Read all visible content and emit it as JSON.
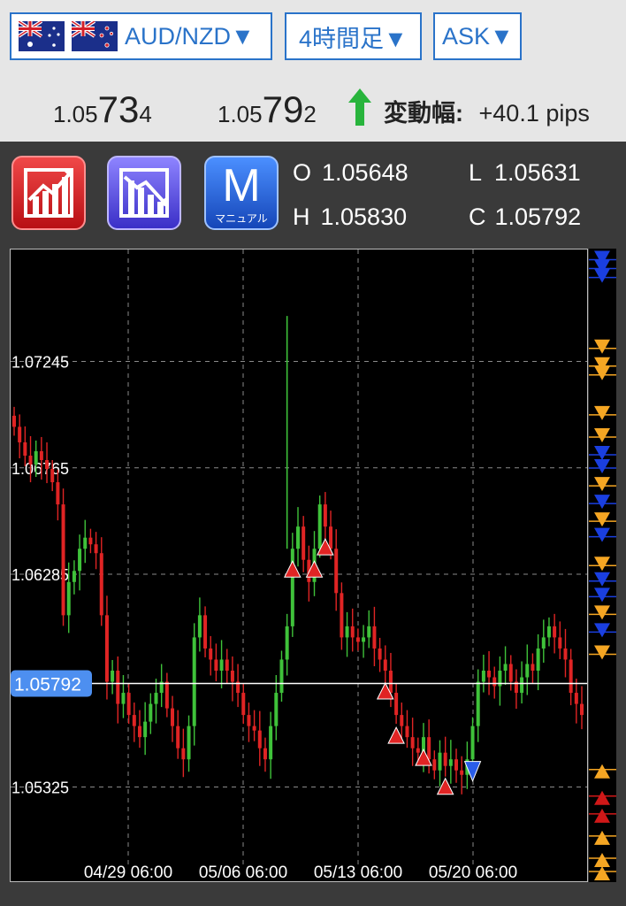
{
  "header": {
    "pair_label": "AUD/NZD▼",
    "timeframe_label": "4時間足▼",
    "side_label": "ASK▼"
  },
  "prices": {
    "bid_prefix": "1.05",
    "bid_big": "73",
    "bid_suffix": "4",
    "ask_prefix": "1.05",
    "ask_big": "79",
    "ask_suffix": "2",
    "range_label": "変動幅:",
    "range_value": "+40.1  pips",
    "direction": "up"
  },
  "toolbar": {
    "manual_letter": "M",
    "manual_sub": "マニュアル"
  },
  "ohlc": {
    "o_label": "O",
    "o_value": "1.05648",
    "h_label": "H",
    "h_value": "1.05830",
    "l_label": "L",
    "l_value": "1.05631",
    "c_label": "C",
    "c_value": "1.05792"
  },
  "colors": {
    "up": "#3fc23a",
    "down": "#e02424",
    "accent": "#2a73c9",
    "current_label_bg": "#4d8ff0",
    "sidebar_orange": "#f5a623",
    "sidebar_blue": "#1a3fe0",
    "sidebar_red": "#d01818"
  },
  "chart_data": {
    "type": "candlestick",
    "pair": "AUD/NZD",
    "timeframe": "4時間足",
    "ylim": [
      1.049,
      1.0775
    ],
    "y_ticks": [
      "1.07245",
      "1.06765",
      "1.06285",
      "1.05325"
    ],
    "y_tick_values": [
      1.07245,
      1.06765,
      1.06285,
      1.05325
    ],
    "current_price": 1.05792,
    "current_price_label": "1.05792",
    "x_ticks": [
      "04/29 06:00",
      "05/06 06:00",
      "05/13 06:00",
      "05/20 06:00"
    ],
    "grid": true,
    "close_series": [
      1.0695,
      1.0688,
      1.0682,
      1.0678,
      1.0684,
      1.068,
      1.0676,
      1.067,
      1.066,
      1.061,
      1.0625,
      1.063,
      1.064,
      1.0645,
      1.0642,
      1.0638,
      1.061,
      1.058,
      1.0585,
      1.057,
      1.0575,
      1.0565,
      1.056,
      1.0555,
      1.0562,
      1.057,
      1.0575,
      1.058,
      1.0568,
      1.056,
      1.055,
      1.0545,
      1.056,
      1.06,
      1.061,
      1.0595,
      1.059,
      1.0585,
      1.059,
      1.0585,
      1.058,
      1.0575,
      1.0565,
      1.056,
      1.0558,
      1.055,
      1.0545,
      1.056,
      1.0575,
      1.059,
      1.0605,
      1.064,
      1.065,
      1.0635,
      1.0625,
      1.064,
      1.066,
      1.065,
      1.064,
      1.062,
      1.06,
      1.0605,
      1.06,
      1.0598,
      1.06,
      1.0605,
      1.0595,
      1.059,
      1.0585,
      1.0575,
      1.0565,
      1.056,
      1.0555,
      1.055,
      1.0548,
      1.0555,
      1.0545,
      1.054,
      1.0548,
      1.0542,
      1.0545,
      1.054,
      1.0538,
      1.0545,
      1.056,
      1.058,
      1.0585,
      1.0582,
      1.0578,
      1.0585,
      1.0588,
      1.058,
      1.0575,
      1.0582,
      1.0588,
      1.0585,
      1.0595,
      1.06,
      1.0605,
      1.06,
      1.0595,
      1.059,
      1.0575,
      1.057,
      1.0565
    ],
    "signals": [
      {
        "type": "sell",
        "index": 51
      },
      {
        "type": "sell",
        "index": 55
      },
      {
        "type": "sell",
        "index": 57
      },
      {
        "type": "sell",
        "index": 68
      },
      {
        "type": "sell",
        "index": 70
      },
      {
        "type": "sell",
        "index": 75
      },
      {
        "type": "sell",
        "index": 79
      },
      {
        "type": "buy",
        "index": 84
      }
    ]
  },
  "sidebar_markers": [
    {
      "dir": "down",
      "color": "blue",
      "price": 1.077
    },
    {
      "dir": "down",
      "color": "blue",
      "price": 1.0766
    },
    {
      "dir": "down",
      "color": "blue",
      "price": 1.0762
    },
    {
      "dir": "down",
      "color": "orange",
      "price": 1.073
    },
    {
      "dir": "down",
      "color": "orange",
      "price": 1.0722
    },
    {
      "dir": "down",
      "color": "orange",
      "price": 1.0718
    },
    {
      "dir": "down",
      "color": "orange",
      "price": 1.07
    },
    {
      "dir": "down",
      "color": "orange",
      "price": 1.069
    },
    {
      "dir": "down",
      "color": "blue",
      "price": 1.0682
    },
    {
      "dir": "down",
      "color": "blue",
      "price": 1.0676
    },
    {
      "dir": "down",
      "color": "orange",
      "price": 1.0668
    },
    {
      "dir": "down",
      "color": "blue",
      "price": 1.066
    },
    {
      "dir": "down",
      "color": "orange",
      "price": 1.0652
    },
    {
      "dir": "down",
      "color": "blue",
      "price": 1.0645
    },
    {
      "dir": "down",
      "color": "orange",
      "price": 1.0632
    },
    {
      "dir": "down",
      "color": "blue",
      "price": 1.0625
    },
    {
      "dir": "down",
      "color": "blue",
      "price": 1.0618
    },
    {
      "dir": "down",
      "color": "orange",
      "price": 1.061
    },
    {
      "dir": "down",
      "color": "blue",
      "price": 1.0602
    },
    {
      "dir": "down",
      "color": "orange",
      "price": 1.0592
    },
    {
      "dir": "up",
      "color": "orange",
      "price": 1.054
    },
    {
      "dir": "up",
      "color": "red",
      "price": 1.0528
    },
    {
      "dir": "up",
      "color": "red",
      "price": 1.052
    },
    {
      "dir": "up",
      "color": "orange",
      "price": 1.051
    },
    {
      "dir": "up",
      "color": "orange",
      "price": 1.05
    },
    {
      "dir": "up",
      "color": "orange",
      "price": 1.0494
    }
  ]
}
